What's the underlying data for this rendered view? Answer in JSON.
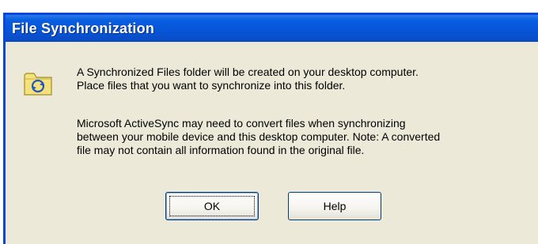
{
  "window": {
    "title": "File Synchronization"
  },
  "icon": {
    "name": "sync-folder-icon",
    "folder_color": "#f5e27a",
    "arrow_color": "#1f56c8"
  },
  "messages": {
    "line1": "A Synchronized Files folder will be created on your desktop computer.\nPlace files that you want to synchronize into this folder.",
    "line2": "Microsoft ActiveSync may need to convert files when synchronizing\nbetween your mobile device and this desktop computer.  Note: A converted\nfile may not contain all information found in the original file."
  },
  "buttons": {
    "ok_label": "OK",
    "help_label": "Help"
  },
  "colors": {
    "titlebar": "#0655d6",
    "dialog_bg": "#ece9d8",
    "button_border": "#003c74"
  }
}
